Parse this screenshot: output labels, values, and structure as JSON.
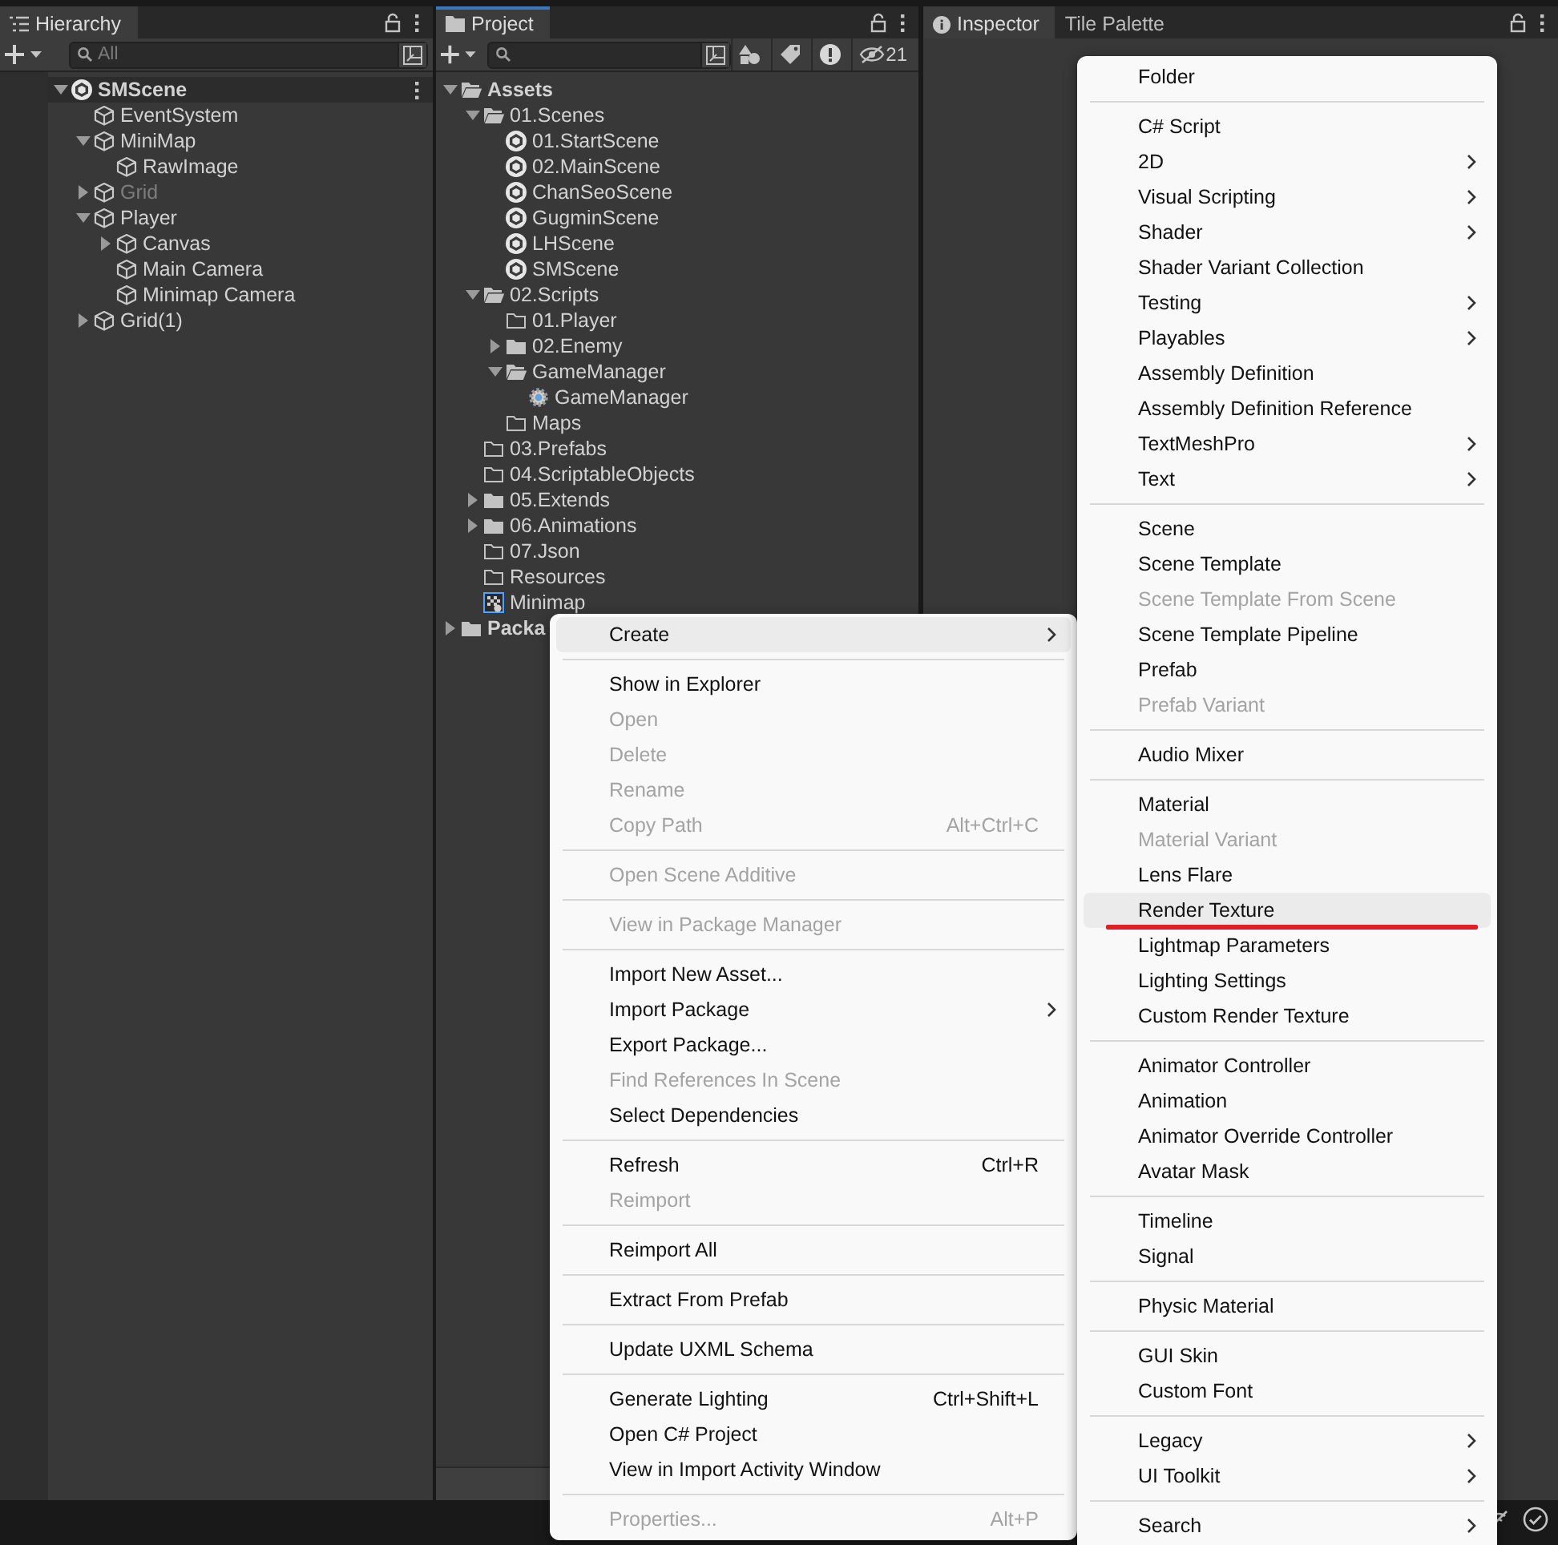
{
  "hierarchy": {
    "tab": {
      "title": "Hierarchy",
      "selected": true
    },
    "search": {
      "placeholder": "All"
    },
    "tree": [
      {
        "label": "SMScene",
        "kind": "scene",
        "expanded": true,
        "disabled": false,
        "children": [
          {
            "label": "EventSystem",
            "kind": "gameobject",
            "disabled": false
          },
          {
            "label": "MiniMap",
            "kind": "gameobject",
            "expanded": true,
            "disabled": false,
            "children": [
              {
                "label": "RawImage",
                "kind": "gameobject",
                "disabled": false
              }
            ]
          },
          {
            "label": "Grid",
            "kind": "gameobject",
            "expanded": false,
            "disabled": true
          },
          {
            "label": "Player",
            "kind": "gameobject",
            "expanded": true,
            "disabled": false,
            "children": [
              {
                "label": "Canvas",
                "kind": "gameobject",
                "expanded": false,
                "disabled": false
              },
              {
                "label": "Main Camera",
                "kind": "gameobject",
                "disabled": false
              },
              {
                "label": "Minimap Camera",
                "kind": "gameobject",
                "disabled": false
              }
            ]
          },
          {
            "label": "Grid(1)",
            "kind": "gameobject",
            "expanded": false,
            "disabled": false
          }
        ]
      }
    ]
  },
  "project": {
    "tab": {
      "title": "Project",
      "selected": true
    },
    "hidden_count": "21",
    "tree": [
      {
        "label": "Assets",
        "kind": "folder-open",
        "expanded": true,
        "children": [
          {
            "label": "01.Scenes",
            "kind": "folder-open",
            "expanded": true,
            "children": [
              {
                "label": "01.StartScene",
                "kind": "scene"
              },
              {
                "label": "02.MainScene",
                "kind": "scene"
              },
              {
                "label": "ChanSeoScene",
                "kind": "scene"
              },
              {
                "label": "GugminScene",
                "kind": "scene"
              },
              {
                "label": "LHScene",
                "kind": "scene"
              },
              {
                "label": "SMScene",
                "kind": "scene"
              }
            ]
          },
          {
            "label": "02.Scripts",
            "kind": "folder-open",
            "expanded": true,
            "children": [
              {
                "label": "01.Player",
                "kind": "folder-empty"
              },
              {
                "label": "02.Enemy",
                "kind": "folder",
                "expanded": false
              },
              {
                "label": "GameManager",
                "kind": "folder-open",
                "expanded": true,
                "children": [
                  {
                    "label": "GameManager",
                    "kind": "script"
                  }
                ]
              },
              {
                "label": "Maps",
                "kind": "folder-empty"
              }
            ]
          },
          {
            "label": "03.Prefabs",
            "kind": "folder-empty"
          },
          {
            "label": "04.ScriptableObjects",
            "kind": "folder-empty"
          },
          {
            "label": "05.Extends",
            "kind": "folder",
            "expanded": false
          },
          {
            "label": "06.Animations",
            "kind": "folder",
            "expanded": false
          },
          {
            "label": "07.Json",
            "kind": "folder-empty"
          },
          {
            "label": "Resources",
            "kind": "folder-empty"
          },
          {
            "label": "Minimap",
            "kind": "render-texture"
          }
        ]
      },
      {
        "label": "Packa",
        "kind": "folder",
        "expanded": false
      }
    ]
  },
  "inspector": {
    "tabs": [
      {
        "label": "Inspector",
        "selected": true
      },
      {
        "label": "Tile Palette",
        "selected": false
      }
    ]
  },
  "context_menu": {
    "items": [
      {
        "kind": "item",
        "label": "Create",
        "disabled": false,
        "highlighted": true,
        "submenu": true
      },
      {
        "kind": "separator"
      },
      {
        "kind": "item",
        "label": "Show in Explorer",
        "disabled": false,
        "highlighted": false,
        "submenu": false
      },
      {
        "kind": "item",
        "label": "Open",
        "disabled": true,
        "highlighted": false,
        "submenu": false
      },
      {
        "kind": "item",
        "label": "Delete",
        "disabled": true,
        "highlighted": false,
        "submenu": false
      },
      {
        "kind": "item",
        "label": "Rename",
        "disabled": true,
        "highlighted": false,
        "submenu": false
      },
      {
        "kind": "item",
        "label": "Copy Path",
        "disabled": true,
        "highlighted": false,
        "submenu": false,
        "shortcut": "Alt+Ctrl+C"
      },
      {
        "kind": "separator"
      },
      {
        "kind": "item",
        "label": "Open Scene Additive",
        "disabled": true,
        "highlighted": false,
        "submenu": false
      },
      {
        "kind": "separator"
      },
      {
        "kind": "item",
        "label": "View in Package Manager",
        "disabled": true,
        "highlighted": false,
        "submenu": false
      },
      {
        "kind": "separator"
      },
      {
        "kind": "item",
        "label": "Import New Asset...",
        "disabled": false,
        "highlighted": false,
        "submenu": false
      },
      {
        "kind": "item",
        "label": "Import Package",
        "disabled": false,
        "highlighted": false,
        "submenu": true
      },
      {
        "kind": "item",
        "label": "Export Package...",
        "disabled": false,
        "highlighted": false,
        "submenu": false
      },
      {
        "kind": "item",
        "label": "Find References In Scene",
        "disabled": true,
        "highlighted": false,
        "submenu": false
      },
      {
        "kind": "item",
        "label": "Select Dependencies",
        "disabled": false,
        "highlighted": false,
        "submenu": false
      },
      {
        "kind": "separator"
      },
      {
        "kind": "item",
        "label": "Refresh",
        "disabled": false,
        "highlighted": false,
        "submenu": false,
        "shortcut": "Ctrl+R"
      },
      {
        "kind": "item",
        "label": "Reimport",
        "disabled": true,
        "highlighted": false,
        "submenu": false
      },
      {
        "kind": "separator"
      },
      {
        "kind": "item",
        "label": "Reimport All",
        "disabled": false,
        "highlighted": false,
        "submenu": false
      },
      {
        "kind": "separator"
      },
      {
        "kind": "item",
        "label": "Extract From Prefab",
        "disabled": false,
        "highlighted": false,
        "submenu": false
      },
      {
        "kind": "separator"
      },
      {
        "kind": "item",
        "label": "Update UXML Schema",
        "disabled": false,
        "highlighted": false,
        "submenu": false
      },
      {
        "kind": "separator"
      },
      {
        "kind": "item",
        "label": "Generate Lighting",
        "disabled": false,
        "highlighted": false,
        "submenu": false,
        "shortcut": "Ctrl+Shift+L"
      },
      {
        "kind": "item",
        "label": "Open C# Project",
        "disabled": false,
        "highlighted": false,
        "submenu": false
      },
      {
        "kind": "item",
        "label": "View in Import Activity Window",
        "disabled": false,
        "highlighted": false,
        "submenu": false
      },
      {
        "kind": "separator"
      },
      {
        "kind": "item",
        "label": "Properties...",
        "disabled": true,
        "highlighted": false,
        "submenu": false,
        "shortcut": "Alt+P"
      }
    ]
  },
  "create_submenu": {
    "items": [
      {
        "kind": "item",
        "label": "Folder",
        "disabled": false,
        "highlighted": false,
        "submenu": false
      },
      {
        "kind": "separator"
      },
      {
        "kind": "item",
        "label": "C# Script",
        "disabled": false,
        "highlighted": false,
        "submenu": false
      },
      {
        "kind": "item",
        "label": "2D",
        "disabled": false,
        "highlighted": false,
        "submenu": true
      },
      {
        "kind": "item",
        "label": "Visual Scripting",
        "disabled": false,
        "highlighted": false,
        "submenu": true
      },
      {
        "kind": "item",
        "label": "Shader",
        "disabled": false,
        "highlighted": false,
        "submenu": true
      },
      {
        "kind": "item",
        "label": "Shader Variant Collection",
        "disabled": false,
        "highlighted": false,
        "submenu": false
      },
      {
        "kind": "item",
        "label": "Testing",
        "disabled": false,
        "highlighted": false,
        "submenu": true
      },
      {
        "kind": "item",
        "label": "Playables",
        "disabled": false,
        "highlighted": false,
        "submenu": true
      },
      {
        "kind": "item",
        "label": "Assembly Definition",
        "disabled": false,
        "highlighted": false,
        "submenu": false
      },
      {
        "kind": "item",
        "label": "Assembly Definition Reference",
        "disabled": false,
        "highlighted": false,
        "submenu": false
      },
      {
        "kind": "item",
        "label": "TextMeshPro",
        "disabled": false,
        "highlighted": false,
        "submenu": true
      },
      {
        "kind": "item",
        "label": "Text",
        "disabled": false,
        "highlighted": false,
        "submenu": true
      },
      {
        "kind": "separator"
      },
      {
        "kind": "item",
        "label": "Scene",
        "disabled": false,
        "highlighted": false,
        "submenu": false
      },
      {
        "kind": "item",
        "label": "Scene Template",
        "disabled": false,
        "highlighted": false,
        "submenu": false
      },
      {
        "kind": "item",
        "label": "Scene Template From Scene",
        "disabled": true,
        "highlighted": false,
        "submenu": false
      },
      {
        "kind": "item",
        "label": "Scene Template Pipeline",
        "disabled": false,
        "highlighted": false,
        "submenu": false
      },
      {
        "kind": "item",
        "label": "Prefab",
        "disabled": false,
        "highlighted": false,
        "submenu": false
      },
      {
        "kind": "item",
        "label": "Prefab Variant",
        "disabled": true,
        "highlighted": false,
        "submenu": false
      },
      {
        "kind": "separator"
      },
      {
        "kind": "item",
        "label": "Audio Mixer",
        "disabled": false,
        "highlighted": false,
        "submenu": false
      },
      {
        "kind": "separator"
      },
      {
        "kind": "item",
        "label": "Material",
        "disabled": false,
        "highlighted": false,
        "submenu": false
      },
      {
        "kind": "item",
        "label": "Material Variant",
        "disabled": true,
        "highlighted": false,
        "submenu": false
      },
      {
        "kind": "item",
        "label": "Lens Flare",
        "disabled": false,
        "highlighted": false,
        "submenu": false
      },
      {
        "kind": "item",
        "label": "Render Texture",
        "disabled": false,
        "highlighted": true,
        "submenu": false,
        "underlined": true
      },
      {
        "kind": "item",
        "label": "Lightmap Parameters",
        "disabled": false,
        "highlighted": false,
        "submenu": false
      },
      {
        "kind": "item",
        "label": "Lighting Settings",
        "disabled": false,
        "highlighted": false,
        "submenu": false
      },
      {
        "kind": "item",
        "label": "Custom Render Texture",
        "disabled": false,
        "highlighted": false,
        "submenu": false
      },
      {
        "kind": "separator"
      },
      {
        "kind": "item",
        "label": "Animator Controller",
        "disabled": false,
        "highlighted": false,
        "submenu": false
      },
      {
        "kind": "item",
        "label": "Animation",
        "disabled": false,
        "highlighted": false,
        "submenu": false
      },
      {
        "kind": "item",
        "label": "Animator Override Controller",
        "disabled": false,
        "highlighted": false,
        "submenu": false
      },
      {
        "kind": "item",
        "label": "Avatar Mask",
        "disabled": false,
        "highlighted": false,
        "submenu": false
      },
      {
        "kind": "separator"
      },
      {
        "kind": "item",
        "label": "Timeline",
        "disabled": false,
        "highlighted": false,
        "submenu": false
      },
      {
        "kind": "item",
        "label": "Signal",
        "disabled": false,
        "highlighted": false,
        "submenu": false
      },
      {
        "kind": "separator"
      },
      {
        "kind": "item",
        "label": "Physic Material",
        "disabled": false,
        "highlighted": false,
        "submenu": false
      },
      {
        "kind": "separator"
      },
      {
        "kind": "item",
        "label": "GUI Skin",
        "disabled": false,
        "highlighted": false,
        "submenu": false
      },
      {
        "kind": "item",
        "label": "Custom Font",
        "disabled": false,
        "highlighted": false,
        "submenu": false
      },
      {
        "kind": "separator"
      },
      {
        "kind": "item",
        "label": "Legacy",
        "disabled": false,
        "highlighted": false,
        "submenu": true
      },
      {
        "kind": "item",
        "label": "UI Toolkit",
        "disabled": false,
        "highlighted": false,
        "submenu": true
      },
      {
        "kind": "separator"
      },
      {
        "kind": "item",
        "label": "Search",
        "disabled": false,
        "highlighted": false,
        "submenu": true
      }
    ]
  }
}
